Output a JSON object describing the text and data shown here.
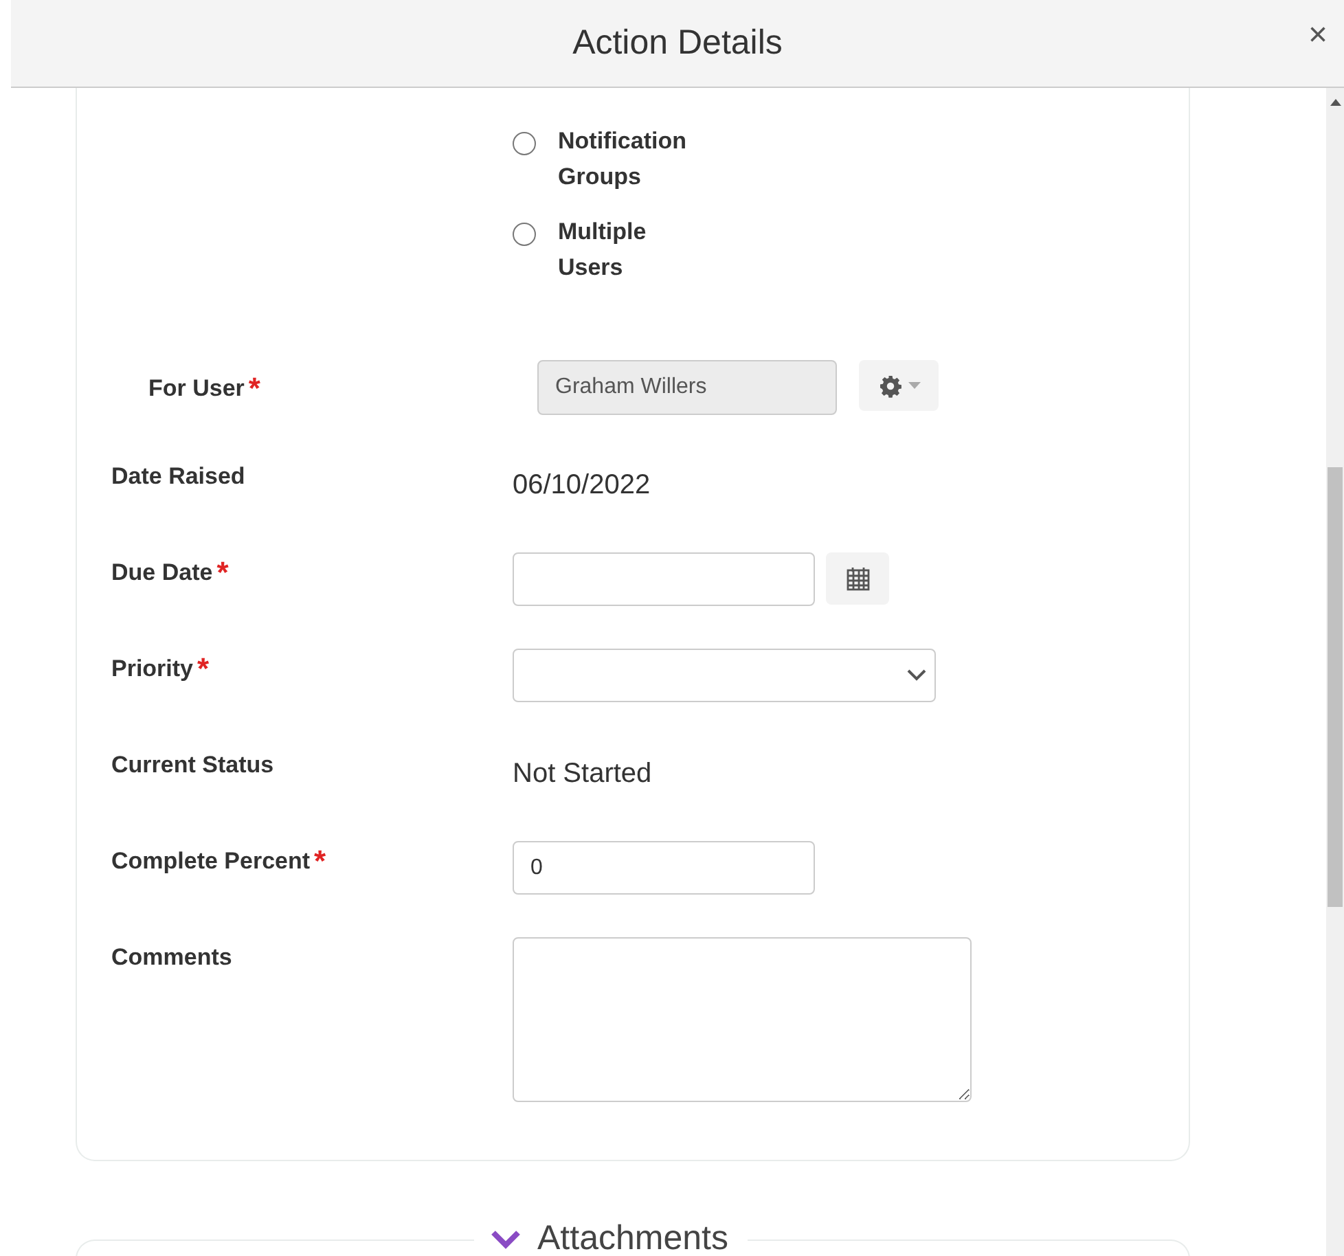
{
  "dialog": {
    "title": "Action Details",
    "close": "×"
  },
  "assign_options": [
    {
      "label": "Notification Groups",
      "selected": false
    },
    {
      "label": "Multiple Users",
      "selected": false
    }
  ],
  "fields": [
    {
      "kind": "user",
      "label": "For User",
      "required_mark": "*",
      "value": "Graham Willers"
    },
    {
      "kind": "static",
      "label": "Date Raised",
      "value": "06/10/2022"
    },
    {
      "kind": "date",
      "label": "Due Date",
      "required_mark": "*"
    },
    {
      "kind": "select",
      "label": "Priority",
      "required_mark": "*"
    },
    {
      "kind": "static",
      "label": "Current Status",
      "value": "Not Started"
    },
    {
      "kind": "number",
      "label": "Complete Percent",
      "required_mark": "*",
      "value": "0"
    },
    {
      "kind": "textarea",
      "label": "Comments"
    }
  ],
  "attachments": {
    "title": "Attachments",
    "expanded": true
  }
}
